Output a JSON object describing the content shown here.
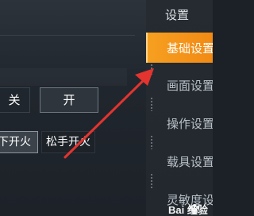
{
  "options": {
    "off": "关",
    "on": "开",
    "fire_press": "下开火",
    "fire_release": "松手开火"
  },
  "menu": {
    "title": "设置",
    "items": [
      {
        "label": "基础设置",
        "active": true
      },
      {
        "label": "画面设置",
        "active": false
      },
      {
        "label": "操作设置",
        "active": false
      },
      {
        "label": "载具设置",
        "active": false
      },
      {
        "label": "灵敏度设",
        "active": false
      }
    ]
  },
  "watermark": {
    "text": "Bai 经验"
  },
  "colors": {
    "active_tab": "#f59a1c",
    "arrow": "#e3342f",
    "panel_bg": "#1d2228"
  },
  "icons": [
    "arrow-annotation-icon",
    "baidu-paw-icon"
  ]
}
